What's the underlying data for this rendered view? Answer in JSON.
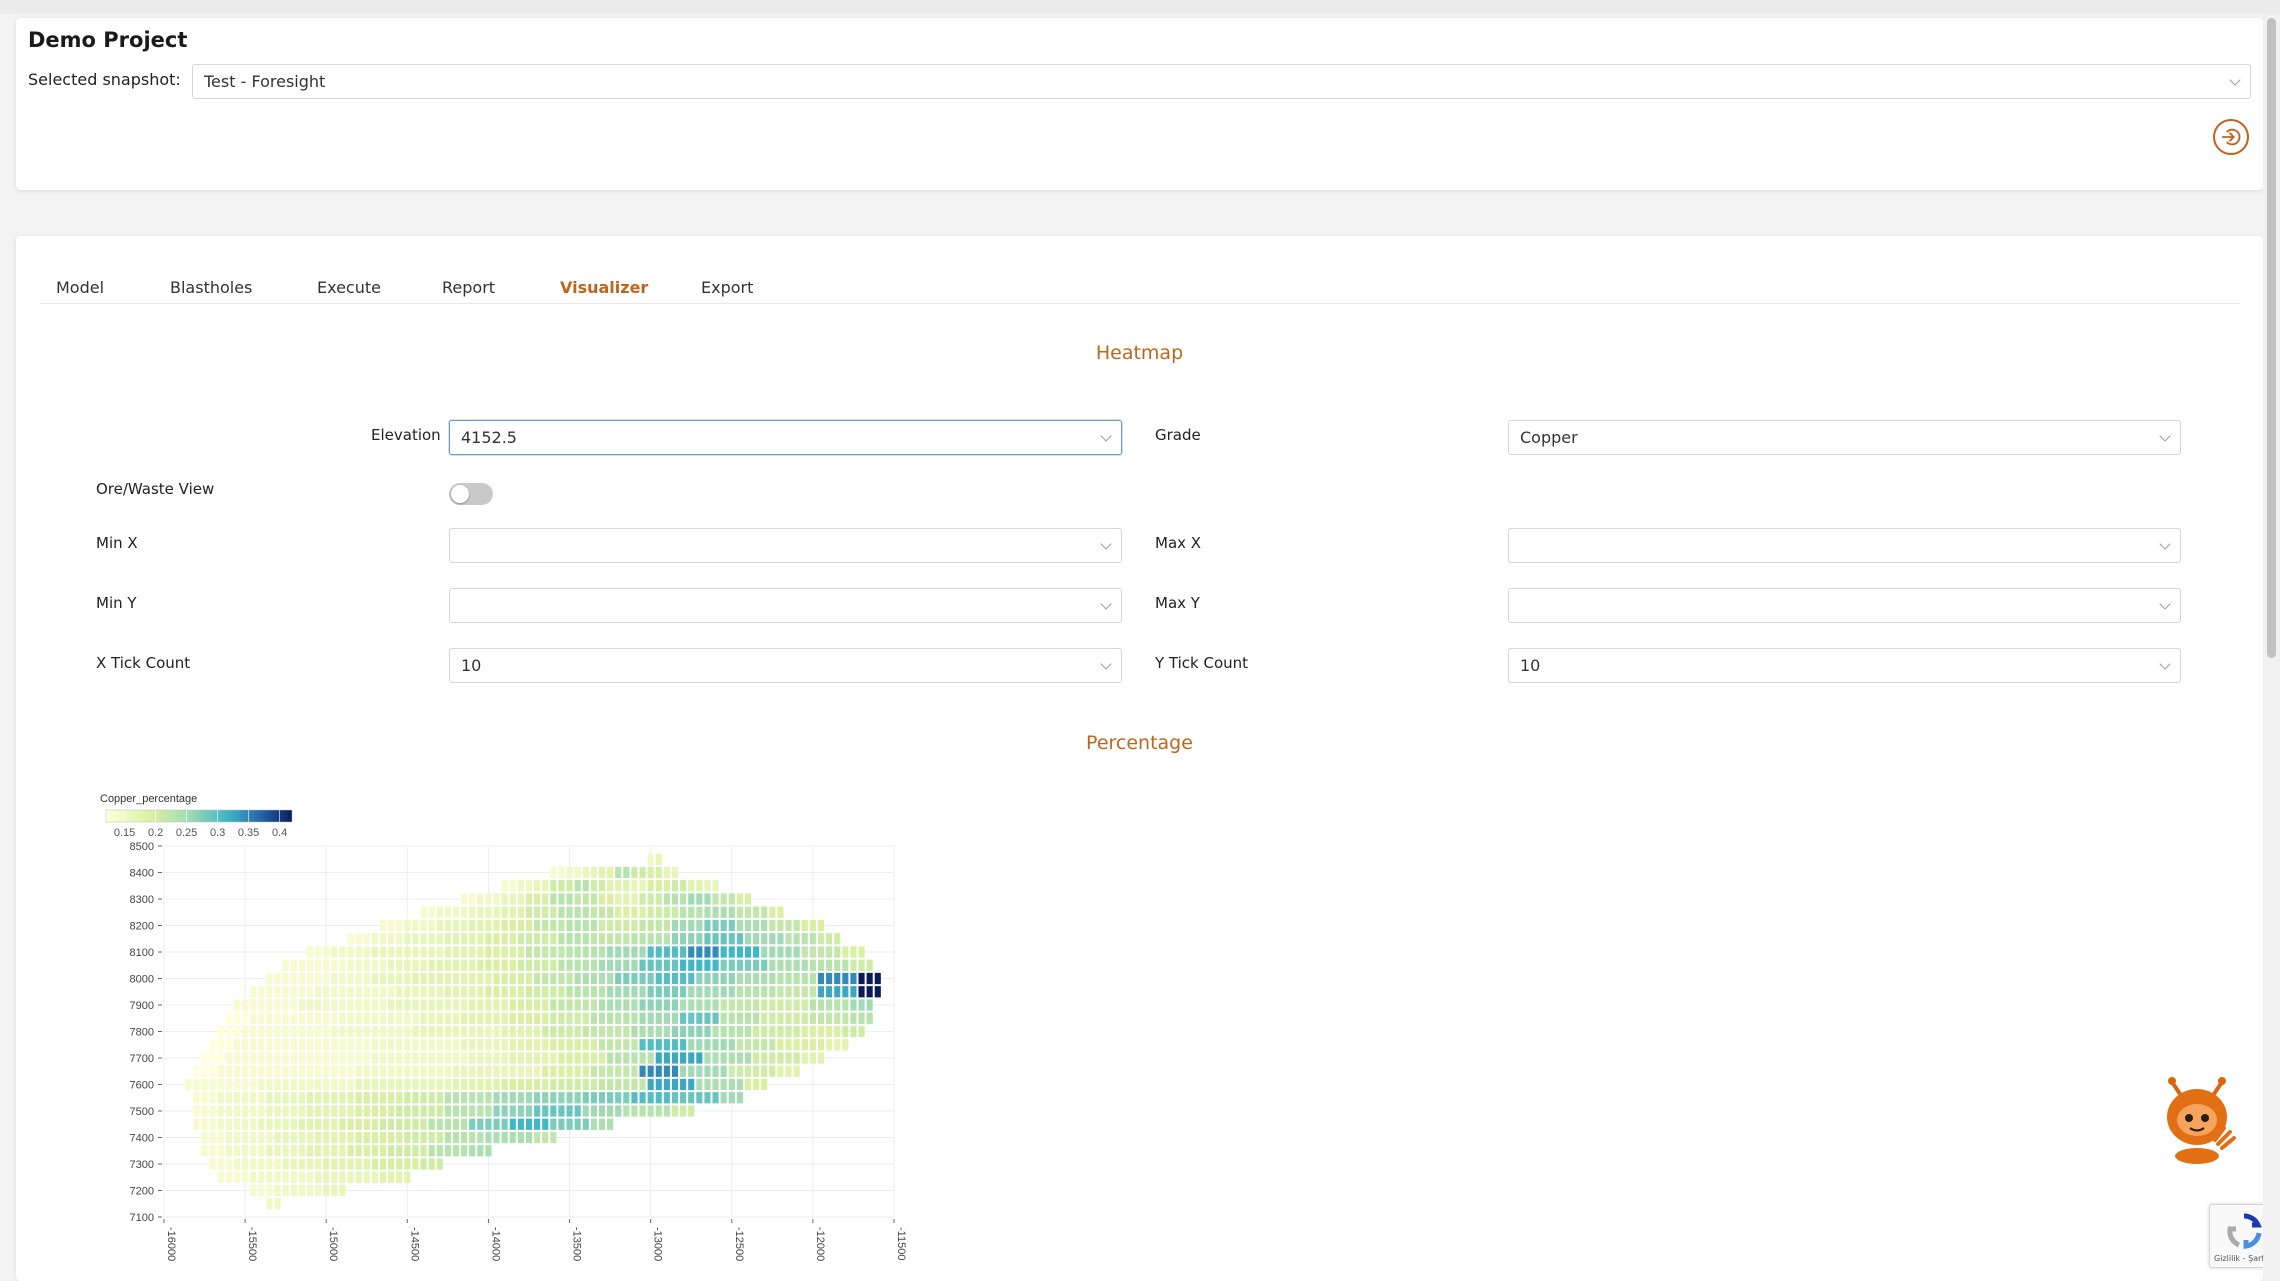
{
  "header": {
    "project_title": "Demo Project",
    "snapshot_label": "Selected snapshot:",
    "snapshot_value": "Test - Foresight"
  },
  "tabs": [
    {
      "label": "Model"
    },
    {
      "label": "Blastholes"
    },
    {
      "label": "Execute"
    },
    {
      "label": "Report"
    },
    {
      "label": "Visualizer"
    },
    {
      "label": "Export"
    }
  ],
  "active_tab": "Visualizer",
  "heatmap_section": {
    "title": "Heatmap",
    "elevation_label": "Elevation",
    "elevation_value": "4152.5",
    "grade_label": "Grade",
    "grade_value": "Copper",
    "ore_waste_label": "Ore/Waste View",
    "ore_waste_on": false,
    "min_x_label": "Min X",
    "min_x_value": "",
    "max_x_label": "Max X",
    "max_x_value": "",
    "min_y_label": "Min Y",
    "min_y_value": "",
    "max_y_label": "Max Y",
    "max_y_value": "",
    "x_tick_label": "X Tick Count",
    "x_tick_value": "10",
    "y_tick_label": "Y Tick Count",
    "y_tick_value": "10"
  },
  "percentage_section": {
    "title": "Percentage"
  },
  "recaptcha": {
    "text": "Gizlilik - Şartlar"
  },
  "colors": {
    "accent": "#c0661c",
    "heat_low": "#ffffd9",
    "heat_mid": "#7fcdbb",
    "heat_high": "#081d58"
  },
  "chart_data": {
    "type": "heatmap",
    "legend_title": "Copper_percentage",
    "legend_ticks": [
      "0.15",
      "0.2",
      "0.25",
      "0.3",
      "0.35",
      "0.4"
    ],
    "color_range": [
      0.12,
      0.42
    ],
    "x_ticks": [
      "-16000",
      "-15500",
      "-15000",
      "-14500",
      "-14000",
      "-13500",
      "-13000",
      "-12500",
      "-12000",
      "-11500"
    ],
    "y_ticks": [
      "8500",
      "8400",
      "8300",
      "8200",
      "8100",
      "8000",
      "7900",
      "7800",
      "7700",
      "7600",
      "7500",
      "7400",
      "7300",
      "7200",
      "7100"
    ],
    "xlim": [
      -16000,
      -11500
    ],
    "ylim": [
      7100,
      8500
    ],
    "cell_size": [
      50,
      50
    ],
    "rows": [
      {
        "y": 8450,
        "x0": -13000,
        "x1": -12950,
        "values": [
          0.14,
          0.15
        ]
      },
      {
        "y": 8400,
        "x0": -13600,
        "x1": -12850,
        "values": [
          0.13,
          0.14,
          0.15,
          0.16,
          0.2,
          0.18,
          0.17,
          0.15
        ]
      },
      {
        "y": 8350,
        "x0": -13900,
        "x1": -12600,
        "values": [
          0.13,
          0.14,
          0.15,
          0.18,
          0.2,
          0.18,
          0.16,
          0.15,
          0.17,
          0.18,
          0.16,
          0.15
        ]
      },
      {
        "y": 8300,
        "x0": -14150,
        "x1": -12400,
        "values": [
          0.13,
          0.14,
          0.15,
          0.17,
          0.2,
          0.19,
          0.17,
          0.16,
          0.18,
          0.2,
          0.22,
          0.19,
          0.17
        ]
      },
      {
        "y": 8250,
        "x0": -14400,
        "x1": -12200,
        "values": [
          0.13,
          0.14,
          0.15,
          0.16,
          0.18,
          0.2,
          0.19,
          0.17,
          0.18,
          0.2,
          0.21,
          0.19,
          0.17
        ]
      },
      {
        "y": 8200,
        "x0": -14650,
        "x1": -11950,
        "values": [
          0.13,
          0.14,
          0.15,
          0.16,
          0.17,
          0.19,
          0.2,
          0.18,
          0.19,
          0.22,
          0.24,
          0.21,
          0.19,
          0.17
        ]
      },
      {
        "y": 8150,
        "x0": -14850,
        "x1": -11850,
        "values": [
          0.13,
          0.14,
          0.15,
          0.16,
          0.17,
          0.18,
          0.2,
          0.19,
          0.2,
          0.23,
          0.25,
          0.22,
          0.2,
          0.18
        ]
      },
      {
        "y": 8100,
        "x0": -15100,
        "x1": -11700,
        "values": [
          0.13,
          0.14,
          0.15,
          0.15,
          0.16,
          0.17,
          0.19,
          0.2,
          0.22,
          0.26,
          0.3,
          0.27,
          0.22,
          0.19,
          0.17
        ]
      },
      {
        "y": 8050,
        "x0": -15250,
        "x1": -11650,
        "values": [
          0.13,
          0.13,
          0.14,
          0.15,
          0.16,
          0.17,
          0.18,
          0.2,
          0.22,
          0.25,
          0.27,
          0.24,
          0.21,
          0.2,
          0.18
        ]
      },
      {
        "y": 8000,
        "x0": -15350,
        "x1": -11600,
        "values": [
          0.13,
          0.13,
          0.14,
          0.15,
          0.16,
          0.16,
          0.17,
          0.19,
          0.21,
          0.24,
          0.26,
          0.23,
          0.21,
          0.2,
          0.3,
          0.42
        ]
      },
      {
        "y": 7950,
        "x0": -15450,
        "x1": -11600,
        "values": [
          0.13,
          0.13,
          0.14,
          0.14,
          0.15,
          0.16,
          0.17,
          0.18,
          0.2,
          0.22,
          0.24,
          0.22,
          0.2,
          0.19,
          0.28,
          0.42
        ]
      },
      {
        "y": 7900,
        "x0": -15550,
        "x1": -11650,
        "values": [
          0.13,
          0.13,
          0.14,
          0.14,
          0.15,
          0.15,
          0.16,
          0.17,
          0.19,
          0.21,
          0.23,
          0.21,
          0.19,
          0.18,
          0.2,
          0.22
        ]
      },
      {
        "y": 7850,
        "x0": -15600,
        "x1": -11650,
        "values": [
          0.12,
          0.13,
          0.13,
          0.14,
          0.14,
          0.15,
          0.16,
          0.17,
          0.18,
          0.2,
          0.22,
          0.25,
          0.2,
          0.18,
          0.19,
          0.2
        ]
      },
      {
        "y": 7800,
        "x0": -15650,
        "x1": -11700,
        "values": [
          0.12,
          0.13,
          0.13,
          0.14,
          0.14,
          0.15,
          0.15,
          0.16,
          0.18,
          0.19,
          0.21,
          0.23,
          0.2,
          0.18,
          0.17,
          0.18
        ]
      },
      {
        "y": 7750,
        "x0": -15700,
        "x1": -11800,
        "values": [
          0.12,
          0.13,
          0.13,
          0.13,
          0.14,
          0.14,
          0.15,
          0.16,
          0.17,
          0.19,
          0.26,
          0.22,
          0.19,
          0.17,
          0.16
        ]
      },
      {
        "y": 7700,
        "x0": -15750,
        "x1": -11950,
        "values": [
          0.12,
          0.13,
          0.13,
          0.13,
          0.14,
          0.14,
          0.15,
          0.16,
          0.17,
          0.2,
          0.28,
          0.21,
          0.18,
          0.16
        ]
      },
      {
        "y": 7650,
        "x0": -15800,
        "x1": -12100,
        "values": [
          0.12,
          0.13,
          0.13,
          0.13,
          0.14,
          0.14,
          0.15,
          0.15,
          0.17,
          0.19,
          0.3,
          0.22,
          0.18,
          0.16
        ]
      },
      {
        "y": 7600,
        "x0": -15850,
        "x1": -12300,
        "values": [
          0.13,
          0.13,
          0.14,
          0.14,
          0.15,
          0.15,
          0.16,
          0.17,
          0.18,
          0.19,
          0.28,
          0.21,
          0.17
        ]
      },
      {
        "y": 7550,
        "x0": -15800,
        "x1": -12450,
        "values": [
          0.13,
          0.14,
          0.15,
          0.16,
          0.17,
          0.18,
          0.2,
          0.22,
          0.23,
          0.24,
          0.26,
          0.25,
          0.22
        ]
      },
      {
        "y": 7500,
        "x0": -15800,
        "x1": -12750,
        "values": [
          0.13,
          0.14,
          0.15,
          0.16,
          0.17,
          0.18,
          0.2,
          0.23,
          0.25,
          0.22,
          0.2,
          0.18
        ]
      },
      {
        "y": 7450,
        "x0": -15800,
        "x1": -13250,
        "values": [
          0.13,
          0.14,
          0.15,
          0.16,
          0.17,
          0.18,
          0.2,
          0.24,
          0.27,
          0.24,
          0.21
        ]
      },
      {
        "y": 7400,
        "x0": -15750,
        "x1": -13600,
        "values": [
          0.13,
          0.14,
          0.15,
          0.16,
          0.17,
          0.18,
          0.2,
          0.21,
          0.19
        ]
      },
      {
        "y": 7350,
        "x0": -15750,
        "x1": -14000,
        "values": [
          0.13,
          0.14,
          0.15,
          0.16,
          0.17,
          0.18,
          0.2,
          0.21
        ]
      },
      {
        "y": 7300,
        "x0": -15700,
        "x1": -14300,
        "values": [
          0.13,
          0.14,
          0.15,
          0.16,
          0.17,
          0.18
        ]
      },
      {
        "y": 7250,
        "x0": -15650,
        "x1": -14500,
        "values": [
          0.13,
          0.14,
          0.15,
          0.16
        ]
      },
      {
        "y": 7200,
        "x0": -15450,
        "x1": -14900,
        "values": [
          0.13,
          0.14,
          0.15
        ]
      },
      {
        "y": 7150,
        "x0": -15350,
        "x1": -15300,
        "values": [
          0.14
        ]
      }
    ]
  }
}
